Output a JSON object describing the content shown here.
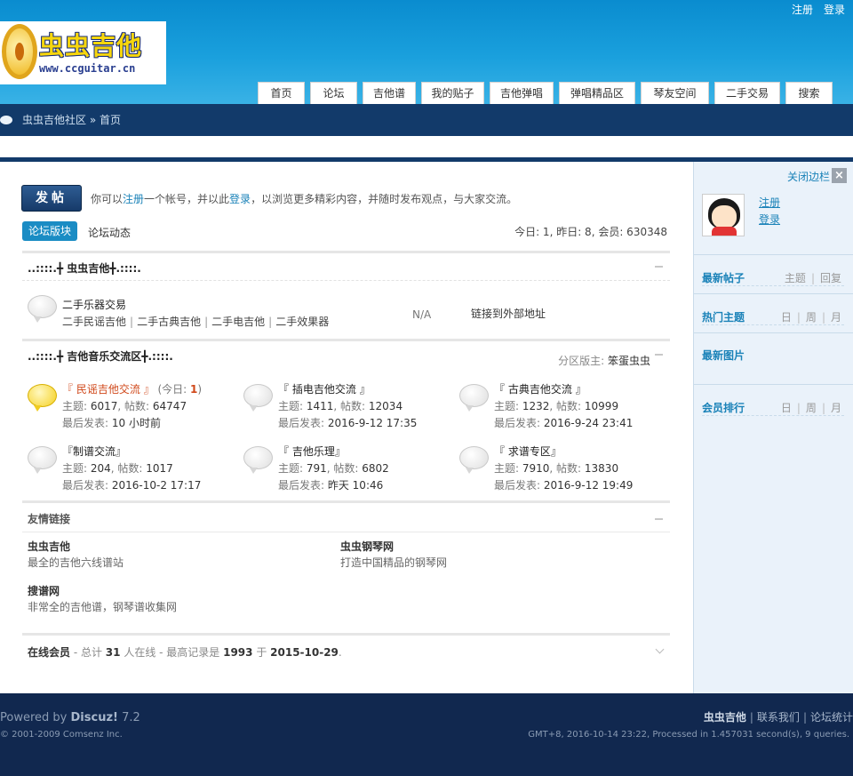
{
  "header": {
    "top_links": [
      "注册",
      "登录"
    ],
    "logo_brand": "虫虫吉他",
    "logo_url": "www.ccguitar.cn",
    "nav": [
      "首页",
      "论坛",
      "吉他谱",
      "我的贴子",
      "吉他弹唱",
      "弹唱精品区",
      "琴友空间",
      "二手交易",
      "搜索"
    ]
  },
  "breadcrumb": {
    "home": "虫虫吉他社区",
    "sep": "»",
    "current": "首页"
  },
  "main": {
    "post_button": "发帖",
    "notice": {
      "t1": "你可以",
      "register": "注册",
      "t2": "一个帐号，并以此",
      "login": "登录",
      "t3": "，以浏览更多精彩内容，并随时发布观点，与大家交流。"
    },
    "tabs": {
      "active": "论坛版块",
      "other": "论坛动态"
    },
    "stats": "今日: 1, 昨日: 8, 会员: 630348",
    "categories": [
      {
        "title": "..::::.╋ 虫虫吉他╋.::::.",
        "forum": {
          "name": "二手乐器交易",
          "subs": [
            "二手民谣吉他",
            "二手古典吉他",
            "二手电吉他",
            "二手效果器"
          ],
          "na": "N/A",
          "external": "链接到外部地址"
        }
      },
      {
        "title": "..::::.╋ 吉他音乐交流区╋.::::.",
        "moderator_label": "分区版主:",
        "moderator": "笨蛋虫虫",
        "forums": [
          {
            "name": "『 民谣吉他交流 』",
            "today_label": "(今日: ",
            "today": "1",
            "today_close": ")",
            "topics": "6017",
            "posts": "64747",
            "last": "10 小时前"
          },
          {
            "name": "『 插电吉他交流 』",
            "topics": "1411",
            "posts": "12034",
            "last": "2016-9-12 17:35"
          },
          {
            "name": "『 古典吉他交流 』",
            "topics": "1232",
            "posts": "10999",
            "last": "2016-9-24 23:41"
          },
          {
            "name": "『制谱交流』",
            "topics": "204",
            "posts": "1017",
            "last": "2016-10-2 17:17"
          },
          {
            "name": "『 吉他乐理』",
            "topics": "791",
            "posts": "6802",
            "last": "昨天 10:46"
          },
          {
            "name": "『 求谱专区』",
            "topics": "7910",
            "posts": "13830",
            "last": "2016-9-12 19:49"
          }
        ],
        "topics_label": "主题: ",
        "posts_label": ", 帖数: ",
        "last_label": "最后发表: "
      }
    ],
    "links": {
      "title": "友情链接",
      "items": [
        {
          "name": "虫虫吉他",
          "desc": "最全的吉他六线谱站"
        },
        {
          "name": "虫虫钢琴网",
          "desc": "打造中国精品的钢琴网"
        },
        {
          "name": "搜谱网",
          "desc": "非常全的吉他谱，钢琴谱收集网"
        }
      ]
    },
    "online": {
      "label": "在线会员",
      "t1": " - 总计 ",
      "count": "31",
      "t2": " 人在线 - 最高记录是 ",
      "record": "1993",
      "t3": " 于 ",
      "date": "2015-10-29",
      "t4": "."
    }
  },
  "sidebar": {
    "close": "关闭边栏",
    "close_x": "×",
    "register": "注册",
    "login": "登录",
    "sections": [
      {
        "title": "最新帖子",
        "opts": [
          "主题",
          "回复"
        ]
      },
      {
        "title": "热门主题",
        "opts": [
          "日",
          "周",
          "月"
        ]
      },
      {
        "title": "最新图片",
        "opts": []
      },
      {
        "title": "会员排行",
        "opts": [
          "日",
          "周",
          "月"
        ]
      }
    ],
    "opt_sep": "|"
  },
  "footer": {
    "powered": "Powered by",
    "product": "Discuz!",
    "version": " 7.2",
    "copyright": "© 2001-2009 Comsenz Inc.",
    "links": [
      "虫虫吉他",
      "联系我们",
      "论坛统计"
    ],
    "link_sep": "|",
    "gmt": "GMT+8, 2016-10-14 23:22, Processed in 1.457031 second(s), 9 queries."
  },
  "colors": {
    "header_blue": "#1aa0dd",
    "dark_navy": "#123a6a",
    "link_blue": "#1a82b8",
    "hot_orange": "#d0481a",
    "footer_bg": "#11284f"
  }
}
